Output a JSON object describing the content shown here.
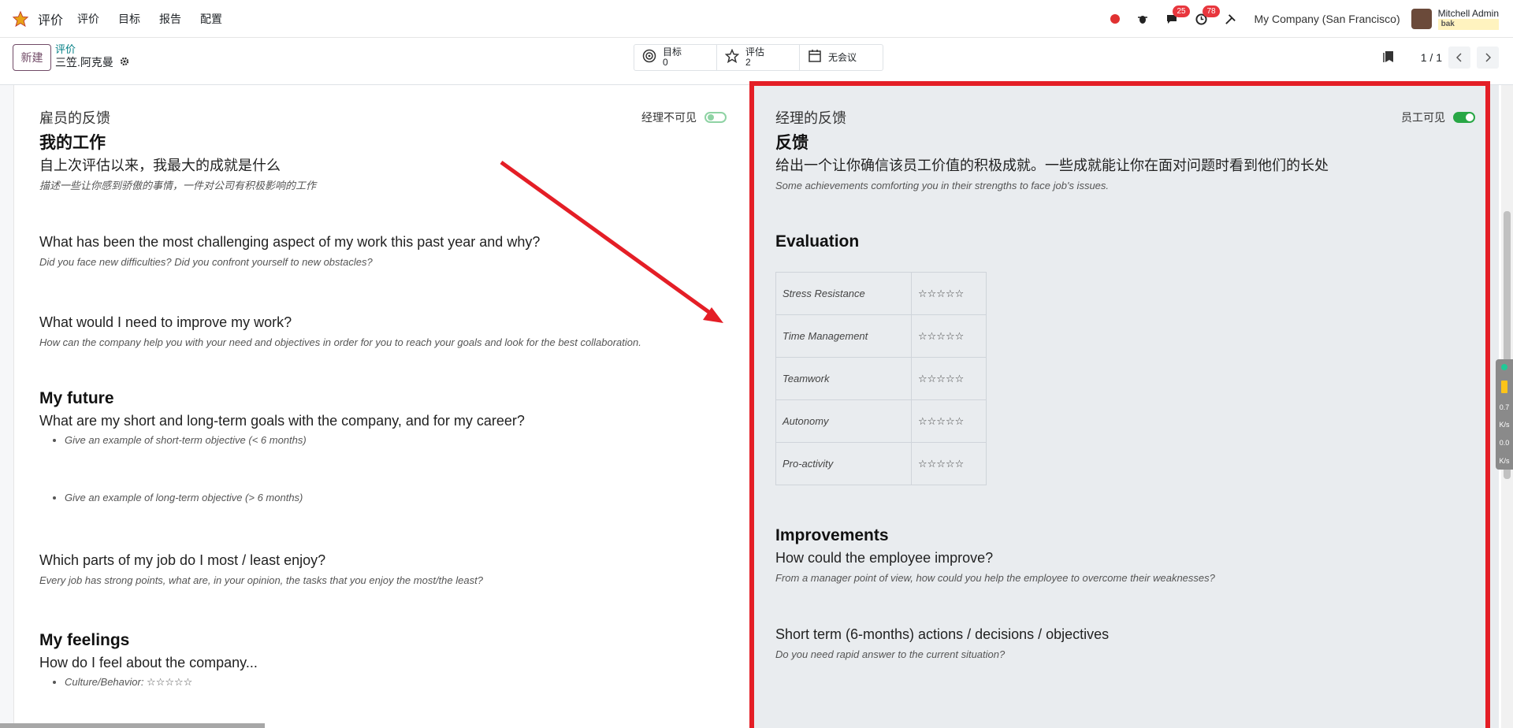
{
  "topbar": {
    "app_name": "评价",
    "menu": [
      "评价",
      "目标",
      "报告",
      "配置"
    ],
    "chat_badge": "25",
    "activity_badge": "78",
    "company": "My Company (San Francisco)",
    "user_name": "Mitchell Admin",
    "db_name": "bak"
  },
  "control": {
    "new_label": "新建",
    "breadcrumb_parent": "评价",
    "breadcrumb_current": "三笠.阿克曼",
    "stats": [
      {
        "label": "目标",
        "value": "0"
      },
      {
        "label": "评估",
        "value": "2"
      },
      {
        "label": "无会议",
        "value": ""
      }
    ],
    "pager": "1 / 1"
  },
  "employee_panel": {
    "title": "雇员的反馈",
    "visibility_label": "经理不可见",
    "sections": {
      "work_title": "我的工作",
      "q1": "自上次评估以来，我最大的成就是什么",
      "q1_hint": "描述一些让你感到骄傲的事情，一件对公司有积极影响的工作",
      "q2": "What has been the most challenging aspect of my work this past year and why?",
      "q2_hint": "Did you face new difficulties? Did you confront yourself to new obstacles?",
      "q3": "What would I need to improve my work?",
      "q3_hint": "How can the company help you with your need and objectives in order for you to reach your goals and look for the best collaboration.",
      "future_title": "My future",
      "q4": "What are my short and long-term goals with the company, and for my career?",
      "q4_b1": "Give an example of short-term objective (< 6 months)",
      "q4_b2": "Give an example of long-term objective (> 6 months)",
      "q5": "Which parts of my job do I most / least enjoy?",
      "q5_hint": "Every job has strong points, what are, in your opinion, the tasks that you enjoy the most/the least?",
      "feelings_title": "My feelings",
      "q6": "How do I feel about the company...",
      "q6_b1": "Culture/Behavior: ☆☆☆☆☆"
    }
  },
  "manager_panel": {
    "title": "经理的反馈",
    "visibility_label": "员工可见",
    "feedback_title": "反馈",
    "feedback_q": "给出一个让你确信该员工价值的积极成就。一些成就能让你在面对问题时看到他们的长处",
    "feedback_hint": "Some achievements comforting you in their strengths to face job's issues.",
    "evaluation_title": "Evaluation",
    "evaluation_rows": [
      {
        "criterion": "Stress Resistance",
        "stars": "☆☆☆☆☆"
      },
      {
        "criterion": "Time Management",
        "stars": "☆☆☆☆☆"
      },
      {
        "criterion": "Teamwork",
        "stars": "☆☆☆☆☆"
      },
      {
        "criterion": "Autonomy",
        "stars": "☆☆☆☆☆"
      },
      {
        "criterion": "Pro-activity",
        "stars": "☆☆☆☆☆"
      }
    ],
    "improvements_title": "Improvements",
    "improve_q": "How could the employee improve?",
    "improve_hint": "From a manager point of view, how could you help the employee to overcome their weaknesses?",
    "short_term_q": "Short term (6-months) actions / decisions / objectives",
    "short_term_hint": "Do you need rapid answer to the current situation?"
  },
  "side_widget": {
    "up": "0.7",
    "up_unit": "K/s",
    "down": "0.0",
    "down_unit": "K/s"
  },
  "colors": {
    "brand": "#714b67",
    "accent": "#017e84",
    "highlight_frame": "#e41e26",
    "toggle_on": "#28a745"
  }
}
